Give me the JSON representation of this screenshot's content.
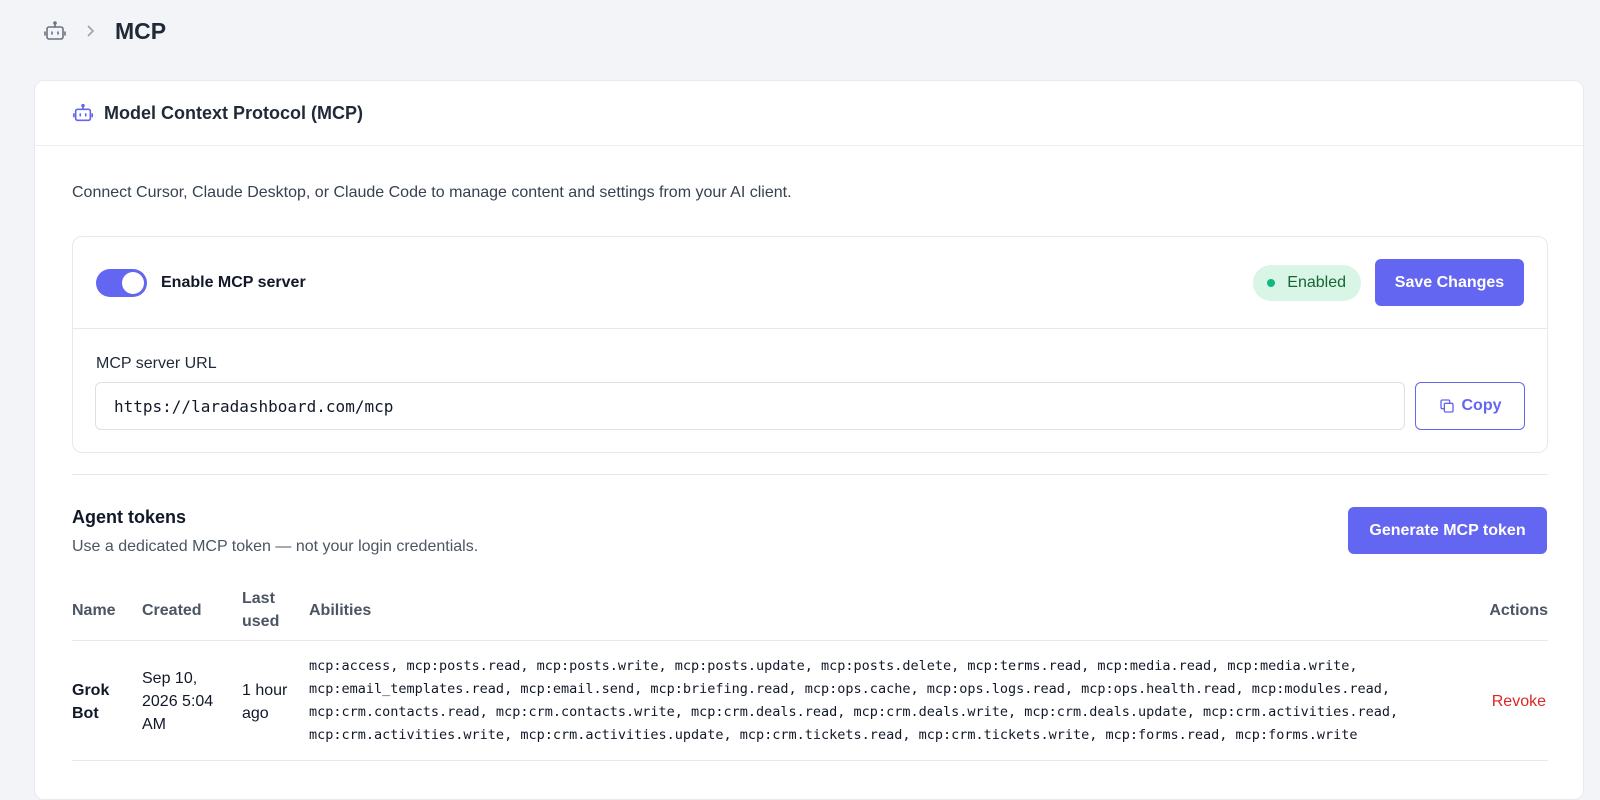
{
  "header": {
    "title": "MCP",
    "bot_icon": "bot-icon",
    "separator_icon": "chevron-right-icon"
  },
  "card": {
    "title": "Model Context Protocol (MCP)",
    "description": "Connect Cursor, Claude Desktop, or Claude Code to manage content and settings from your AI client."
  },
  "server": {
    "toggle_label": "Enable MCP server",
    "toggle_on": true,
    "status": "Enabled",
    "save_label": "Save Changes",
    "url_label": "MCP server URL",
    "url_value": "https://laradashboard.com/mcp",
    "copy_label": "Copy"
  },
  "tokens": {
    "title": "Agent tokens",
    "subtitle": "Use a dedicated MCP token — not your login credentials.",
    "generate_label": "Generate MCP token",
    "columns": {
      "name": "Name",
      "created": "Created",
      "last_used_1": "Last",
      "last_used_2": "used",
      "abilities": "Abilities",
      "actions": "Actions"
    },
    "rows": [
      {
        "name_1": "Grok",
        "name_2": "Bot",
        "created_1": "Sep 10,",
        "created_2": "2026 5:04",
        "created_3": "AM",
        "last_used_1": "1 hour",
        "last_used_2": "ago",
        "abilities_1": "mcp:access, mcp:posts.read, mcp:posts.write, mcp:posts.update, mcp:posts.delete, mcp:terms.read, mcp:media.read, mcp:media.write,",
        "abilities_2": "mcp:email_templates.read, mcp:email.send, mcp:briefing.read, mcp:ops.cache, mcp:ops.logs.read, mcp:ops.health.read, mcp:modules.read,",
        "abilities_3": "mcp:crm.contacts.read, mcp:crm.contacts.write, mcp:crm.deals.read, mcp:crm.deals.write, mcp:crm.deals.update, mcp:crm.activities.read,",
        "abilities_4": "mcp:crm.activities.write, mcp:crm.activities.update, mcp:crm.tickets.read, mcp:crm.tickets.write, mcp:forms.read, mcp:forms.write",
        "action": "Revoke"
      }
    ]
  },
  "colors": {
    "accent": "#6366f1",
    "success_bg": "#d8f5e6",
    "success_text": "#166534",
    "danger": "#dc2626"
  }
}
